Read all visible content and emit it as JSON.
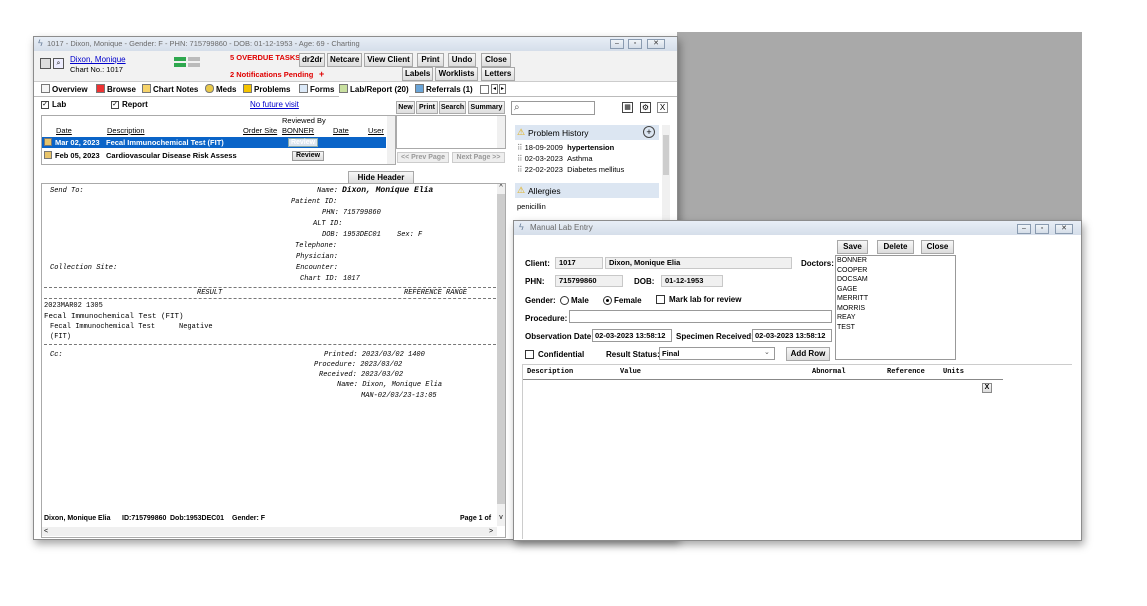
{
  "main_window": {
    "title": "1017 - Dixon, Monique - Gender: F - PHN: 715799860 - DOB: 01-12-1953 - Age: 69 - Charting",
    "patient_name": "Dixon, Monique",
    "chart_no": "Chart No.: 1017",
    "overdue_tasks": "5 OVERDUE TASKS",
    "notifications": "2 Notifications Pending",
    "notif_plus": "+",
    "toolbar": {
      "dr2dr": "dr2dr",
      "netcare": "Netcare",
      "view_client": "View Client",
      "print": "Print",
      "undo": "Undo",
      "close": "Close",
      "labels": "Labels",
      "worklists": "Worklists",
      "letters": "Letters"
    },
    "tabs": [
      {
        "label": "Overview"
      },
      {
        "label": "Browse"
      },
      {
        "label": "Chart Notes"
      },
      {
        "label": "Meds"
      },
      {
        "label": "Problems"
      },
      {
        "label": "Forms"
      },
      {
        "label": "Lab/Report (20)"
      },
      {
        "label": "Referrals (1)"
      }
    ],
    "filters": {
      "lab": "Lab",
      "report": "Report",
      "future_visit": "No future visit",
      "new": "New",
      "print": "Print",
      "search": "Search",
      "summary": "Summary"
    },
    "list": {
      "reviewed_by": "Reviewed By",
      "columns": {
        "date": "Date",
        "description": "Description",
        "order_site": "Order Site",
        "bonner": "BONNER",
        "date2": "Date",
        "user": "User"
      },
      "rows": [
        {
          "date": "Mar 02, 2023",
          "description": "Fecal Immunochemical Test (FIT)",
          "review": "Review"
        },
        {
          "date": "Feb 05, 2023",
          "description": "Cardiovascular Disease Risk Assess",
          "review": "Review"
        }
      ],
      "prev_page": "<< Prev Page",
      "next_page": "Next Page >>"
    },
    "hide_header": "Hide Header",
    "report": {
      "send_to": "Send To:",
      "name_label": "Name:",
      "name_value": "Dixon, Monique Elia",
      "patient_id_label": "Patient ID:",
      "phn_label": "PHN:",
      "phn_value": "715799860",
      "alt_id_label": "ALT ID:",
      "dob_label": "DOB:",
      "dob_value": "1953DEC01",
      "sex": "Sex: F",
      "telephone_label": "Telephone:",
      "physician_label": "Physician:",
      "collection_site": "Collection Site:",
      "encounter_label": "Encounter:",
      "chart_id_label": "Chart ID:",
      "chart_id_value": "1017",
      "result_header": "RESULT",
      "reference_header": "REFERENCE RANGE",
      "timestamp": "2023MAR02 1305",
      "test_title": "Fecal Immunochemical Test (FIT)",
      "test_line1": "Fecal Immunochemical Test",
      "test_result": "Negative",
      "test_line2": "(FIT)",
      "cc": "Cc:",
      "printed": "Printed: 2023/03/02 1400",
      "procedure": "Procedure: 2023/03/02",
      "received": "Received: 2023/03/02",
      "name2": "Name: Dixon, Monique Elia",
      "man": "MAN-02/03/23-13:05"
    },
    "footer": {
      "patient": "Dixon, Monique Elia",
      "id": "ID:715799860",
      "dob": "Dob:1953DEC01",
      "gender": "Gender: F",
      "page": "Page 1 of"
    }
  },
  "sidebar": {
    "search_placeholder": "",
    "problem_history": "Problem History",
    "problems": [
      {
        "date": "18-09-2009",
        "name": "hypertension"
      },
      {
        "date": "02-03-2023",
        "name": "Asthma"
      },
      {
        "date": "22-02-2023",
        "name": "Diabetes mellitus"
      }
    ],
    "allergies": "Allergies",
    "allergy_items": [
      "penicillin"
    ]
  },
  "lab_entry": {
    "title": "Manual Lab Entry",
    "save": "Save",
    "delete": "Delete",
    "close": "Close",
    "client_label": "Client:",
    "client_id": "1017",
    "client_name": "Dixon, Monique Elia",
    "doctors_label": "Doctors:",
    "doctors": [
      "BONNER",
      "COOPER",
      "DOCSAM",
      "GAGE",
      "MERRITT",
      "MORRIS",
      "REAY",
      "TEST"
    ],
    "phn_label": "PHN:",
    "phn_value": "715799860",
    "dob_label": "DOB:",
    "dob_value": "01-12-1953",
    "gender_label": "Gender:",
    "male": "Male",
    "female": "Female",
    "mark_review": "Mark lab for review",
    "procedure_label": "Procedure:",
    "observation_label": "Observation Date:",
    "observation_value": "02-03-2023 13:58:12",
    "specimen_label": "Specimen Received:",
    "specimen_value": "02-03-2023 13:58:12",
    "confidential": "Confidential",
    "result_status_label": "Result Status:",
    "result_status_value": "Final",
    "add_row": "Add Row",
    "columns": {
      "description": "Description",
      "value": "Value",
      "abnormal": "Abnormal",
      "reference": "Reference",
      "units": "Units"
    },
    "remove_row": "X"
  },
  "colors": {
    "selected_row": "#0a64c8",
    "alert_red": "#e00000",
    "link_blue": "#0000cc"
  }
}
